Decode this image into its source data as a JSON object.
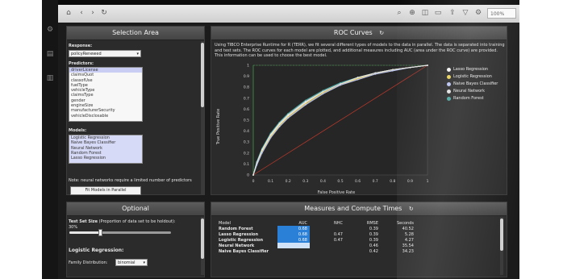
{
  "toolbar": {
    "icons": [
      "home-icon",
      "back-icon",
      "forward-icon",
      "refresh-icon",
      "search-icon",
      "zoom-in-icon",
      "bookmark-icon",
      "comment-icon",
      "share-icon",
      "settings-icon"
    ],
    "zoom": "100%"
  },
  "rail": {
    "icons": [
      "gear-icon",
      "document-icon",
      "chart-icon"
    ]
  },
  "selection": {
    "title": "Selection Area",
    "response_label": "Response:",
    "response_value": "policyRenewed",
    "predictors_label": "Predictors:",
    "predictors": [
      "driverLicense",
      "claimsQuot",
      "classofUse",
      "fuelType",
      "vehicleType",
      "claimsType",
      "gender",
      "engineSize",
      "manufacturerSecurity",
      "vehicleDisclosable"
    ],
    "models_label": "Models:",
    "models": [
      "Logistic Regression",
      "Naive Bayes Classifier",
      "Neural Network",
      "Random Forest",
      "Lasso Regression"
    ],
    "note": "Note: neural networks require a limited number of predictors",
    "fit_button": "Fit Models in Parallel"
  },
  "roc": {
    "title": "ROC Curves",
    "description": "Using TIBCO Enterprise Runtime for R (TERR), we fit several different types of models to the data in parallel. The data is separated into training and test sets. The ROC curves for each model are plotted, and additional measures including AUC (area under the ROC curve) are provided. This information can be used to choose the best model.",
    "legend": [
      {
        "name": "Lasso Regression",
        "color": "#f2f2f2"
      },
      {
        "name": "Logistic Regression",
        "color": "#e8d15a"
      },
      {
        "name": "Naive Bayes Classifier",
        "color": "#b9c3f0"
      },
      {
        "name": "Neural Network",
        "color": "#e0e0e0"
      },
      {
        "name": "Random Forest",
        "color": "#4aa6a0"
      }
    ]
  },
  "chart_data": {
    "type": "line",
    "title": "",
    "xlabel": "False Positive Rate",
    "ylabel": "True Positive Rate",
    "xlim": [
      0,
      1
    ],
    "ylim": [
      0,
      1
    ],
    "xticks": [
      "0",
      "0.1",
      "0.2",
      "0.3",
      "0.4",
      "0.5",
      "0.6",
      "0.7",
      "0.8",
      "0.9",
      "1"
    ],
    "yticks": [
      "0",
      "0.1",
      "0.2",
      "0.3",
      "0.4",
      "0.5",
      "0.6",
      "0.7",
      "0.8",
      "0.9",
      "1"
    ],
    "reference_line": {
      "x": [
        0,
        1
      ],
      "y": [
        0,
        1
      ],
      "color": "#c0392b"
    },
    "series": [
      {
        "name": "Random Forest",
        "color": "#4aa6a0",
        "x": [
          0,
          0.02,
          0.05,
          0.1,
          0.15,
          0.2,
          0.3,
          0.4,
          0.5,
          0.6,
          0.7,
          0.8,
          0.9,
          1
        ],
        "y": [
          0,
          0.12,
          0.24,
          0.38,
          0.48,
          0.56,
          0.68,
          0.77,
          0.84,
          0.89,
          0.93,
          0.96,
          0.98,
          1
        ]
      },
      {
        "name": "Lasso Regression",
        "color": "#f2f2f2",
        "x": [
          0,
          0.02,
          0.05,
          0.1,
          0.15,
          0.2,
          0.3,
          0.4,
          0.5,
          0.6,
          0.7,
          0.8,
          0.9,
          1
        ],
        "y": [
          0,
          0.1,
          0.22,
          0.36,
          0.46,
          0.54,
          0.66,
          0.76,
          0.83,
          0.88,
          0.93,
          0.96,
          0.98,
          1
        ]
      },
      {
        "name": "Logistic Regression",
        "color": "#e8d15a",
        "x": [
          0,
          0.02,
          0.05,
          0.1,
          0.15,
          0.2,
          0.3,
          0.4,
          0.5,
          0.6,
          0.7,
          0.8,
          0.9,
          1
        ],
        "y": [
          0,
          0.1,
          0.21,
          0.35,
          0.45,
          0.53,
          0.65,
          0.75,
          0.82,
          0.88,
          0.92,
          0.96,
          0.98,
          1
        ]
      },
      {
        "name": "Naive Bayes Classifier",
        "color": "#b9c3f0",
        "x": [
          0,
          0.02,
          0.05,
          0.1,
          0.15,
          0.2,
          0.3,
          0.4,
          0.5,
          0.6,
          0.7,
          0.8,
          0.9,
          1
        ],
        "y": [
          0,
          0.09,
          0.2,
          0.34,
          0.44,
          0.52,
          0.64,
          0.74,
          0.82,
          0.87,
          0.92,
          0.95,
          0.98,
          1
        ]
      },
      {
        "name": "Neural Network",
        "color": "#e0e0e0",
        "x": [
          0,
          0.02,
          0.05,
          0.1,
          0.15,
          0.2,
          0.3,
          0.4,
          0.5,
          0.6,
          0.7,
          0.8,
          0.9,
          1
        ],
        "y": [
          0,
          0.11,
          0.23,
          0.37,
          0.47,
          0.55,
          0.67,
          0.76,
          0.83,
          0.89,
          0.93,
          0.96,
          0.98,
          1
        ]
      }
    ]
  },
  "optional": {
    "title": "Optional",
    "test_size_label": "Test Set Size",
    "test_size_hint": "(Proportion of data set to be holdout):",
    "test_size_value": "30%",
    "test_size_fraction": 0.3,
    "logistic_label": "Logistic Regression:",
    "family_label": "Family Distribution:",
    "family_value": "binomial"
  },
  "measures": {
    "title": "Measures and Compute Times",
    "columns": [
      "Model",
      "AUC",
      "NHC",
      "RMSE",
      "Seconds"
    ],
    "rows": [
      {
        "model": "Random Forest",
        "auc": "0.68",
        "nhc": "",
        "rmse": "0.39",
        "seconds": "40.52"
      },
      {
        "model": "Lasso Regression",
        "auc": "0.68",
        "nhc": "0.47",
        "rmse": "0.39",
        "seconds": "5.28"
      },
      {
        "model": "Logistic Regression",
        "auc": "0.68",
        "nhc": "0.47",
        "rmse": "0.39",
        "seconds": "4.27"
      },
      {
        "model": "Neural Network",
        "auc": "",
        "nhc": "",
        "rmse": "0.46",
        "seconds": "35.54"
      },
      {
        "model": "Naive Bayes Classifier",
        "auc": "",
        "nhc": "",
        "rmse": "0.42",
        "seconds": "34.23"
      }
    ]
  }
}
